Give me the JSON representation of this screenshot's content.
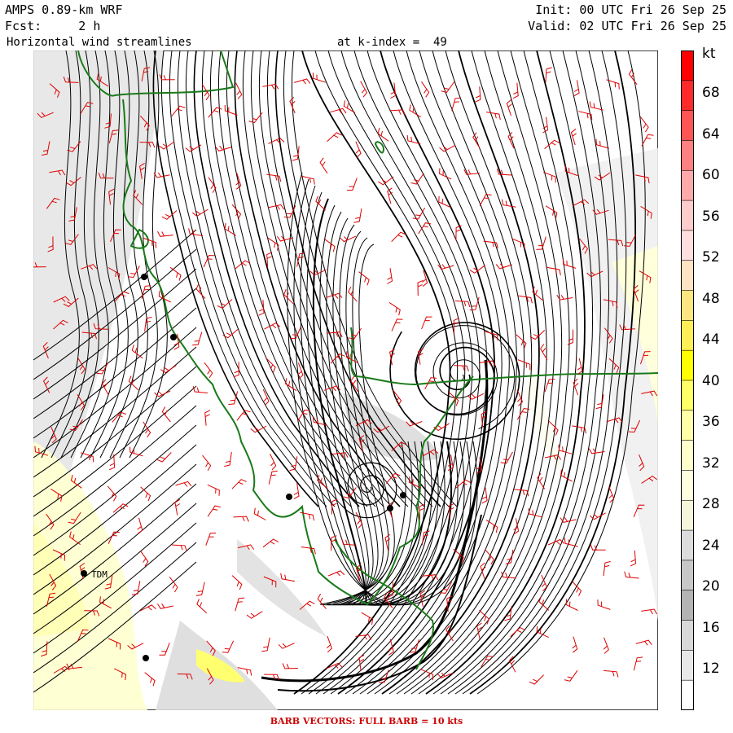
{
  "header": {
    "model": "AMPS 0.89-km WRF",
    "fcst": "Fcst:     2 h",
    "init": "Init: 00 UTC Fri 26 Sep 25",
    "valid": "Valid: 02 UTC Fri 26 Sep 25",
    "field": "Horizontal wind streamlines",
    "level": "at k-index =  49"
  },
  "legend": {
    "unit": "kt",
    "labels": [
      "68",
      "64",
      "60",
      "56",
      "52",
      "48",
      "44",
      "40",
      "36",
      "32",
      "28",
      "24",
      "20",
      "16",
      "12"
    ],
    "colors": [
      "#ff0000",
      "#ff2a2a",
      "#ff5555",
      "#ff8080",
      "#ffaaaa",
      "#ffcccc",
      "#ffdede",
      "#ffe4c4",
      "#ffe680",
      "#ffee55",
      "#ffff00",
      "#ffff66",
      "#ffffaa",
      "#ffffcc",
      "#ffffe0",
      "#f5f5dc",
      "#dcdcdc",
      "#c8c8c8",
      "#b4b4b4",
      "#d8d8d8",
      "#e8e8e8",
      "#ffffff"
    ]
  },
  "stations": [
    {
      "label": "TDM"
    }
  ],
  "footer": "BARB VECTORS:  FULL BARB = 10 kts",
  "colors": {
    "streamline": "#000000",
    "barb": "#dd0000",
    "coast": "#1a7a1a"
  }
}
